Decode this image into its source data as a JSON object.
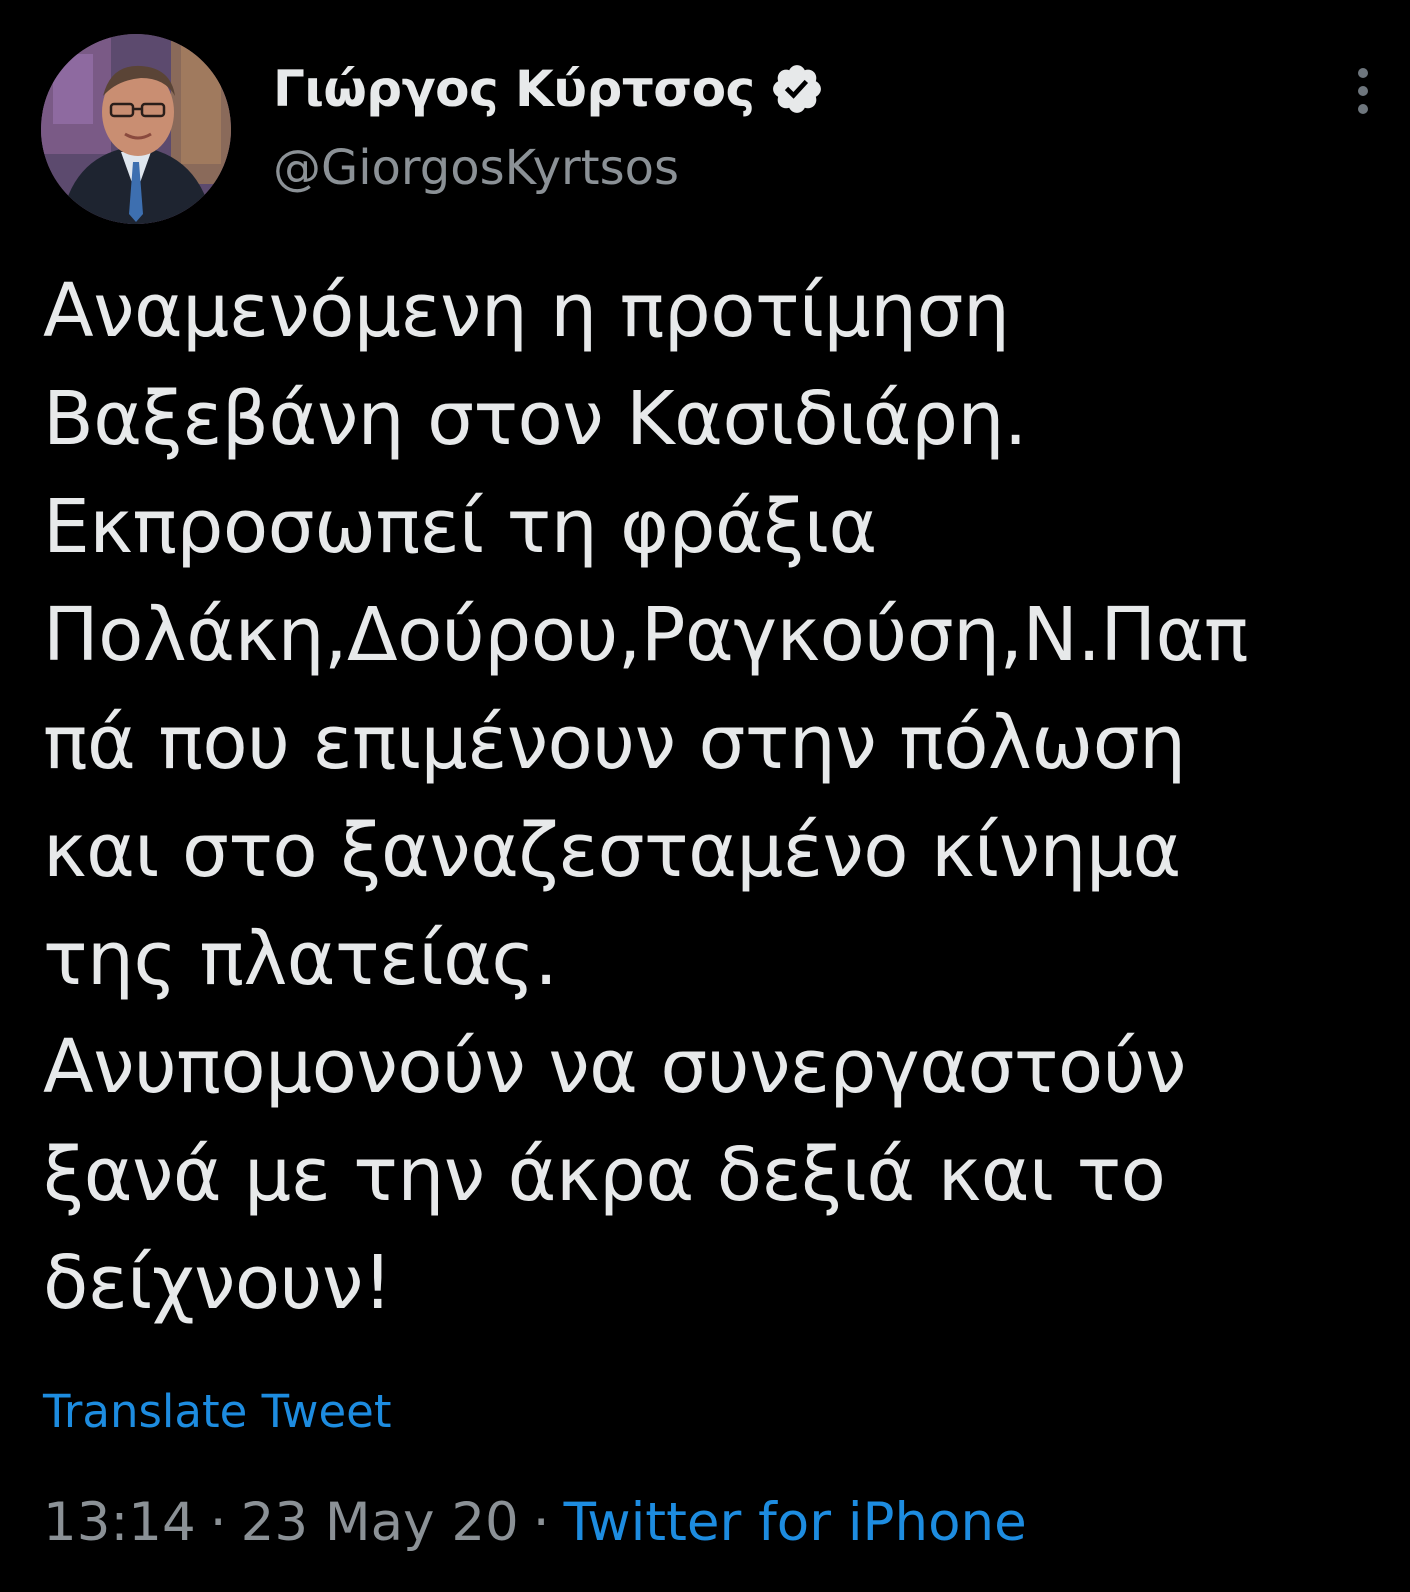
{
  "tweet": {
    "author": {
      "display_name": "Γιώργος Κύρτσος",
      "handle": "@GiorgosKyrtsos",
      "verified": true,
      "avatar_icon": "profile-photo"
    },
    "more_icon": "more-vertical-icon",
    "text": "Αναμενόμενη η προτίμηση\nΒαξεβάνη στον Κασιδιάρη.\nΕκπροσωπεί τη φράξια\nΠολάκη,Δούρου,Ραγκούση,Ν.Παπ\nπά που επιμένουν στην πόλωση\nκαι στο ξαναζεσταμένο κίνημα\nτης πλατείας.\nΑνυπομονούν να συνεργαστούν\nξανά με την άκρα δεξιά και το\nδείχνουν!",
    "translate_label": "Translate Tweet",
    "time": "13:14",
    "separator": "·",
    "date": "23 May 20",
    "source": "Twitter for iPhone"
  },
  "colors": {
    "background": "#000000",
    "text": "#e7e9ea",
    "secondary": "#8b9196",
    "link": "#1d8ce0"
  }
}
